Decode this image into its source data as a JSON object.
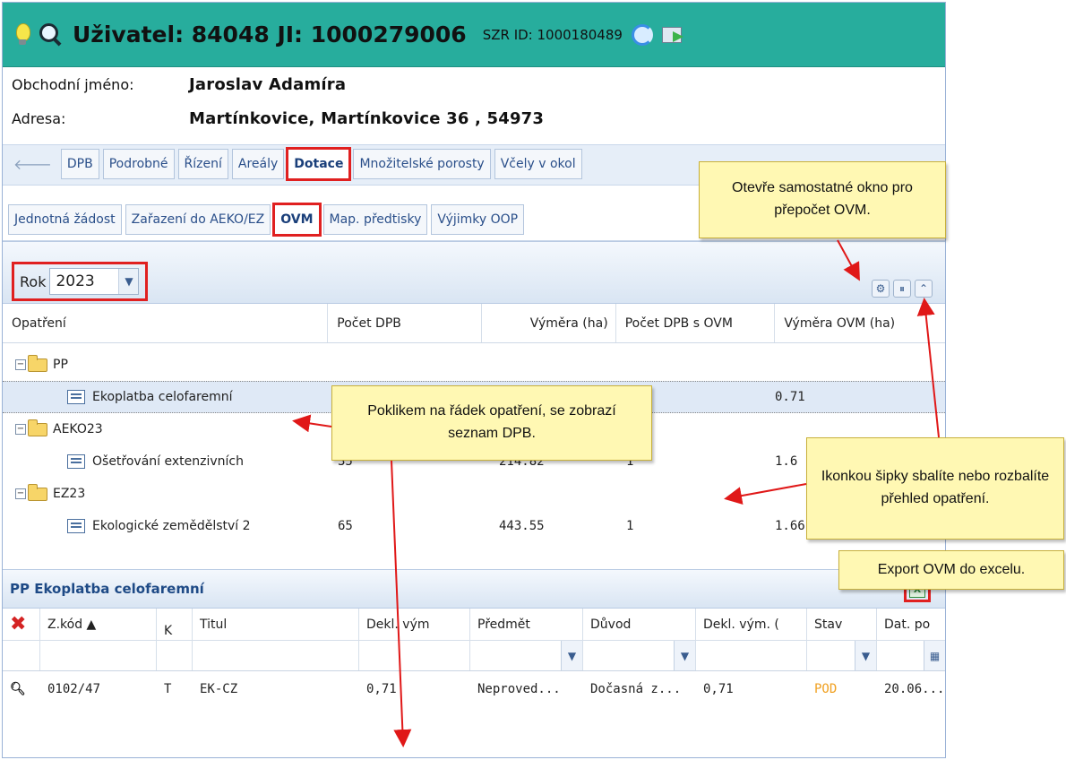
{
  "header": {
    "title": "Uživatel: 84048 JI: 1000279006",
    "szr": "SZR ID: 1000180489"
  },
  "info": {
    "name_label": "Obchodní jméno:",
    "name_value": "Jaroslav Adamíra",
    "address_label": "Adresa:",
    "address_value": "Martínkovice, Martínkovice 36 , 54973"
  },
  "main_tabs": [
    "DPB",
    "Podrobné",
    "Řízení",
    "Areály",
    "Dotace",
    "Množitelské porosty",
    "Včely v okol"
  ],
  "sub_tabs": [
    "Jednotná žádost",
    "Zařazení do AEKO/EZ",
    "OVM",
    "Map. předtisky",
    "Výjimky OOP"
  ],
  "toolbar": {
    "year_label": "Rok",
    "year_value": "2023"
  },
  "grid": {
    "columns": [
      "Opatření",
      "Počet DPB",
      "Výměra (ha)",
      "Počet DPB s OVM",
      "Výměra OVM (ha)"
    ],
    "groups": [
      {
        "name": "PP",
        "items": [
          {
            "name": "Ekoplatba celofaremní",
            "count": "",
            "area": "",
            "count_ovm": "",
            "area_ovm": "0.71"
          }
        ]
      },
      {
        "name": "AEKO23",
        "items": [
          {
            "name": "Ošetřování extenzivních",
            "count": "35",
            "area": "214.82",
            "count_ovm": "1",
            "area_ovm": "1.6"
          }
        ]
      },
      {
        "name": "EZ23",
        "items": [
          {
            "name": "Ekologické zemědělství 2",
            "count": "65",
            "area": "443.55",
            "count_ovm": "1",
            "area_ovm": "1.66"
          }
        ]
      }
    ]
  },
  "detail": {
    "title": "PP Ekoplatba celofaremní",
    "columns": [
      "Z.kód ▲",
      "K",
      "Titul",
      "Dekl. vým",
      "Předmět",
      "Důvod",
      "Dekl. vým. (",
      "Stav",
      "Dat. po"
    ],
    "row": [
      "0102/47",
      "T",
      "EK-CZ",
      "0,71",
      "Neproved...",
      "Dočasná z...",
      "0,71",
      "POD",
      "20.06...."
    ],
    "status_color": "#f0a020"
  },
  "callouts": {
    "window": "Otevře samostatné okno pro přepočet OVM.",
    "row_click": "Poklikem na řádek opatření, se zobrazí seznam DPB.",
    "collapse": "Ikonkou šipky sbalíte nebo rozbalíte přehled opatření.",
    "export": "Export OVM do excelu."
  },
  "icons": [
    "bulb-icon",
    "magnifier-icon",
    "refresh-icon",
    "export-icon",
    "gear-icon",
    "pin-icon",
    "collapse-icon",
    "excel-icon",
    "delete-icon",
    "search-icon"
  ]
}
